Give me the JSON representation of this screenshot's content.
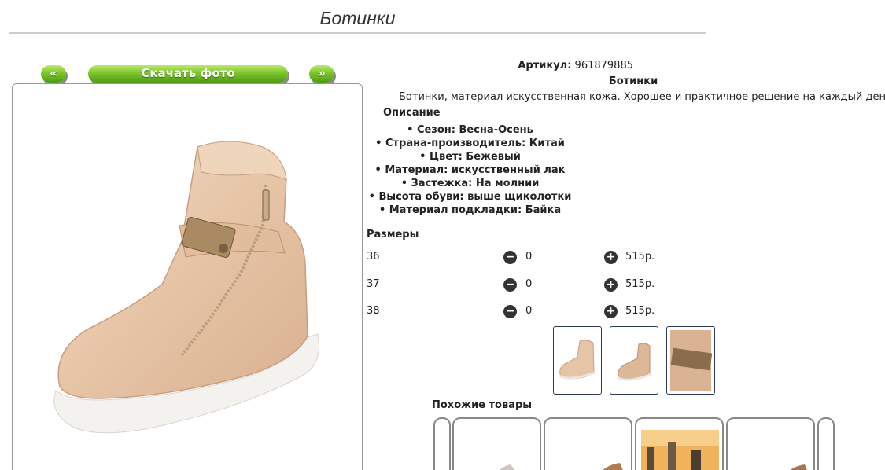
{
  "page": {
    "title": "Ботинки"
  },
  "toolbar": {
    "prev_label": "«",
    "download_label": "Скачать фото",
    "next_label": "»"
  },
  "product": {
    "article_label": "Артикул:",
    "article_value": "961879885",
    "name": "Ботинки",
    "short_description": "Ботинки, материал искусственная кожа. Хорошее и практичное решение на каждый день.",
    "description_heading": "Описание",
    "features": [
      "Сезон: Весна-Осень",
      "Страна-производитель: Китай",
      "Цвет: Бежевый",
      "Материал: искусственный лак",
      "Застежка: На молнии",
      "Высота обуви: выше щиколотки",
      "Материал подкладки: Байка"
    ]
  },
  "sizes": {
    "heading": "Размеры",
    "rows": [
      {
        "size": "36",
        "qty": "0",
        "price": "515р."
      },
      {
        "size": "37",
        "qty": "0",
        "price": "515р."
      },
      {
        "size": "38",
        "qty": "0",
        "price": "515р."
      }
    ]
  },
  "similar": {
    "heading": "Похожие товары"
  },
  "colors": {
    "accent_green": "#7dc52c",
    "icon_dark": "#333333",
    "shoe_beige": "#e6c7ab"
  }
}
